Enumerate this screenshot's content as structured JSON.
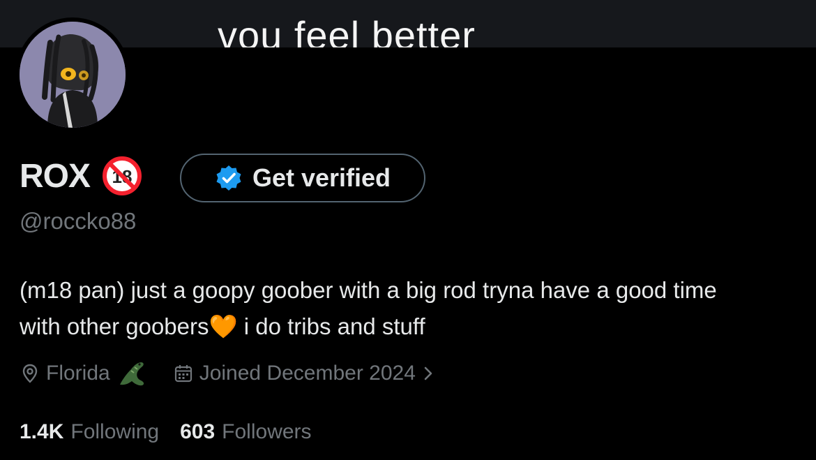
{
  "banner": {
    "text": "vou feel better"
  },
  "profile": {
    "display_name": "ROX",
    "handle": "@roccko88",
    "get_verified_label": "Get verified",
    "bio_line1": "(m18 pan) just a goopy goober with a big rod tryna have a good time",
    "bio_line2": "with other goobers",
    "bio_heart": "🧡",
    "bio_line2_tail": " i do tribs and stuff",
    "location": "Florida",
    "joined": "Joined December 2024",
    "following_count": "1.4K",
    "following_label": "Following",
    "followers_count": "603",
    "followers_label": "Followers"
  },
  "icons": {
    "age": "no-under-18-icon",
    "verified": "verified-badge-icon",
    "location": "location-pin-icon",
    "alligator": "alligator-icon",
    "calendar": "calendar-icon",
    "chevron": "chevron-right-icon"
  },
  "colors": {
    "background": "#000000",
    "text_primary": "#e7e9ea",
    "text_secondary": "#71767b",
    "verified_blue": "#1d9bf0",
    "button_border": "#536471",
    "age_red": "#f4212e",
    "heart_orange": "#f4900c",
    "avatar_bg": "#8c88ad"
  }
}
